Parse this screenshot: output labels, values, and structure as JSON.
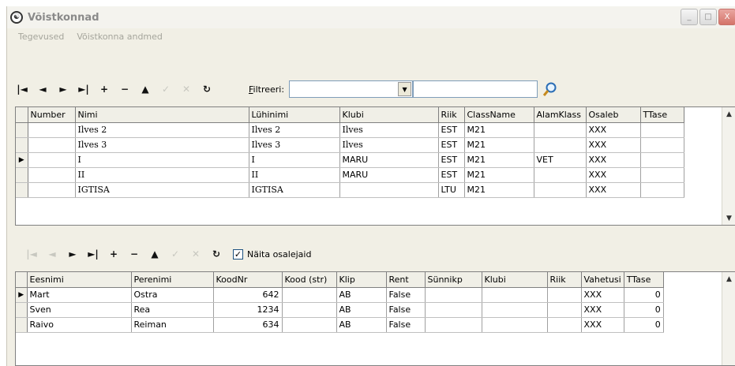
{
  "window": {
    "title": "Võistkonnad",
    "icon": "yin-yang-app-icon",
    "buttons": {
      "minimize": "_",
      "maximize": "□",
      "close": "X"
    }
  },
  "menu": [
    "Tegevused",
    "Võistkonna andmed"
  ],
  "toolbar_top": {
    "first": "|◄",
    "prev": "◄",
    "next": "►",
    "last": "►|",
    "add": "+",
    "delete": "−",
    "edit": "▲",
    "post": "✓",
    "cancel": "✕",
    "refresh": "↻",
    "filter_label": "Filtreeri:",
    "filter_accel": "F",
    "filter_rest": "iltreeri:",
    "filter_value": "",
    "filter_text": "",
    "search_icon": "magnifier-icon"
  },
  "teams_grid": {
    "columns": [
      "Number",
      "Nimi",
      "Lühinimi",
      "Klubi",
      "Riik",
      "ClassName",
      "AlamKlass",
      "Osaleb",
      "TTase"
    ],
    "rows": [
      [
        "",
        "Ilves 2",
        "Ilves 2",
        "Ilves",
        "EST",
        "M21",
        "",
        "XXX",
        ""
      ],
      [
        "",
        "Ilves 3",
        "Ilves 3",
        "Ilves",
        "EST",
        "M21",
        "",
        "XXX",
        ""
      ],
      [
        "",
        "I",
        "I",
        "MARU",
        "EST",
        "M21",
        "VET",
        "XXX",
        ""
      ],
      [
        "",
        "II",
        "II",
        "MARU",
        "EST",
        "M21",
        "",
        "XXX",
        ""
      ],
      [
        "",
        "IGTISA",
        "IGTISA",
        "",
        "LTU",
        "M21",
        "",
        "XXX",
        ""
      ]
    ],
    "current_row": 2
  },
  "toolbar_bottom": {
    "first": "|◄",
    "prev": "◄",
    "next": "►",
    "last": "►|",
    "add": "+",
    "delete": "−",
    "edit": "▲",
    "post": "✓",
    "cancel": "✕",
    "refresh": "↻",
    "show_members_label": "Näita osalejaid",
    "show_members_checked": "✓"
  },
  "members_grid": {
    "columns": [
      "Eesnimi",
      "Perenimi",
      "KoodNr",
      "Kood (str)",
      "Klip",
      "Rent",
      "Sünnikp",
      "Klubi",
      "Riik",
      "Vahetusi",
      "TTase"
    ],
    "rows": [
      [
        "Mart",
        "Ostra",
        "642",
        "",
        "AB",
        "False",
        "",
        "",
        "",
        "XXX",
        "0"
      ],
      [
        "Sven",
        "Rea",
        "1234",
        "",
        "AB",
        "False",
        "",
        "",
        "",
        "XXX",
        "0"
      ],
      [
        "Raivo",
        "Reiman",
        "634",
        "",
        "AB",
        "False",
        "",
        "",
        "",
        "XXX",
        "0"
      ]
    ],
    "current_row": 0
  },
  "colors": {
    "window_bg": "#f1efe5",
    "grid_header": "#f0efe7",
    "disabled": "#c8c8c0"
  }
}
